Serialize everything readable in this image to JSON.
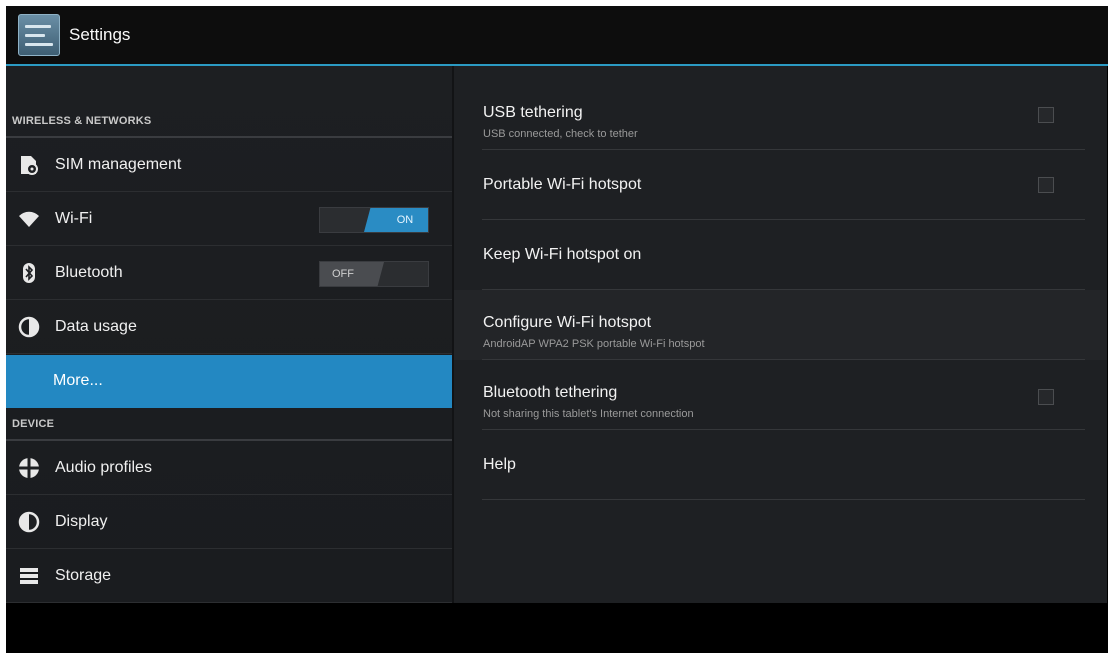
{
  "action_bar": {
    "title": "Settings",
    "icon": "settings-sliders-icon"
  },
  "sidebar": {
    "sections": [
      {
        "label": "WIRELESS & NETWORKS"
      },
      {
        "label": "DEVICE"
      }
    ],
    "items": [
      {
        "label": "SIM management",
        "icon": "sim-card-icon"
      },
      {
        "label": "Wi-Fi",
        "icon": "wifi-icon",
        "toggle": "ON"
      },
      {
        "label": "Bluetooth",
        "icon": "bluetooth-icon",
        "toggle": "OFF"
      },
      {
        "label": "Data usage",
        "icon": "data-usage-icon"
      },
      {
        "label": "More...",
        "selected": true
      },
      {
        "label": "Audio profiles",
        "icon": "audio-profiles-icon"
      },
      {
        "label": "Display",
        "icon": "display-icon"
      },
      {
        "label": "Storage",
        "icon": "storage-icon"
      }
    ]
  },
  "content": {
    "prefs": [
      {
        "title": "USB tethering",
        "summary": "USB connected, check to tether",
        "checkbox": true
      },
      {
        "title": "Portable Wi-Fi hotspot",
        "checkbox": true
      },
      {
        "title": "Keep Wi-Fi hotspot on"
      },
      {
        "title": "Configure Wi-Fi hotspot",
        "summary": "AndroidAP WPA2 PSK portable Wi-Fi hotspot"
      },
      {
        "title": "Bluetooth tethering",
        "summary": "Not sharing this tablet's Internet connection",
        "checkbox": true
      },
      {
        "title": "Help"
      }
    ]
  },
  "colors": {
    "accent": "#33b5e5",
    "selected": "#2388c2",
    "background": "#1e2023"
  }
}
